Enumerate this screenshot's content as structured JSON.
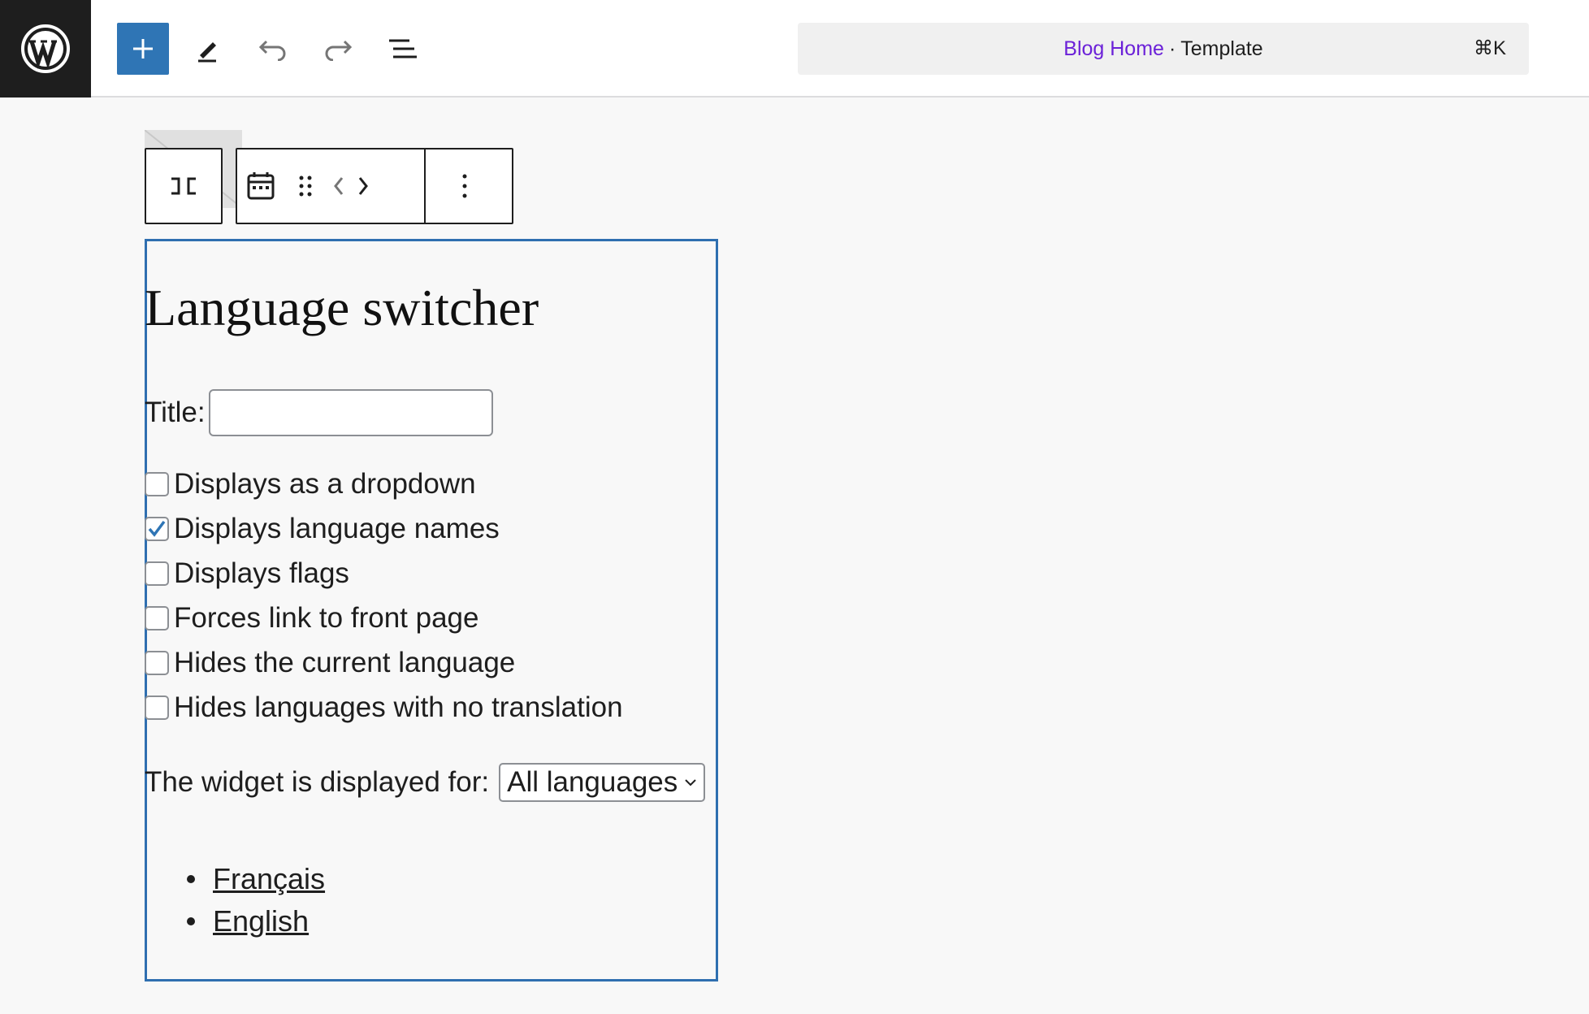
{
  "topbar": {
    "logo_icon": "wordpress-logo-icon",
    "add_block_icon": "plus-icon",
    "tools_icon": "pencil-icon",
    "undo_icon": "undo-icon",
    "redo_icon": "redo-icon",
    "document_overview_icon": "list-view-icon",
    "command": {
      "link": "Blog Home",
      "separator": "·",
      "suffix": "Template",
      "shortcut": "⌘K"
    }
  },
  "block_toolbar": {
    "icons": [
      "block-type-icon",
      "calendar-icon",
      "drag-handle-icon",
      "chevron-left-icon",
      "chevron-right-icon",
      "more-options-icon"
    ]
  },
  "widget": {
    "heading": "Language switcher",
    "title_label": "Title:",
    "title_value": "",
    "options": [
      {
        "label": "Displays as a dropdown",
        "checked": false
      },
      {
        "label": "Displays language names",
        "checked": true
      },
      {
        "label": "Displays flags",
        "checked": false
      },
      {
        "label": "Forces link to front page",
        "checked": false
      },
      {
        "label": "Hides the current language",
        "checked": false
      },
      {
        "label": "Hides languages with no translation",
        "checked": false
      }
    ],
    "display_for_label": "The widget is displayed for:",
    "display_for_value": "All languages",
    "languages": [
      "Français",
      "English"
    ]
  },
  "colors": {
    "accent": "#2f75b5",
    "command_link": "#6b21d8",
    "block_border": "#2f6fb0",
    "checkbox_check": "#2f75b5"
  }
}
